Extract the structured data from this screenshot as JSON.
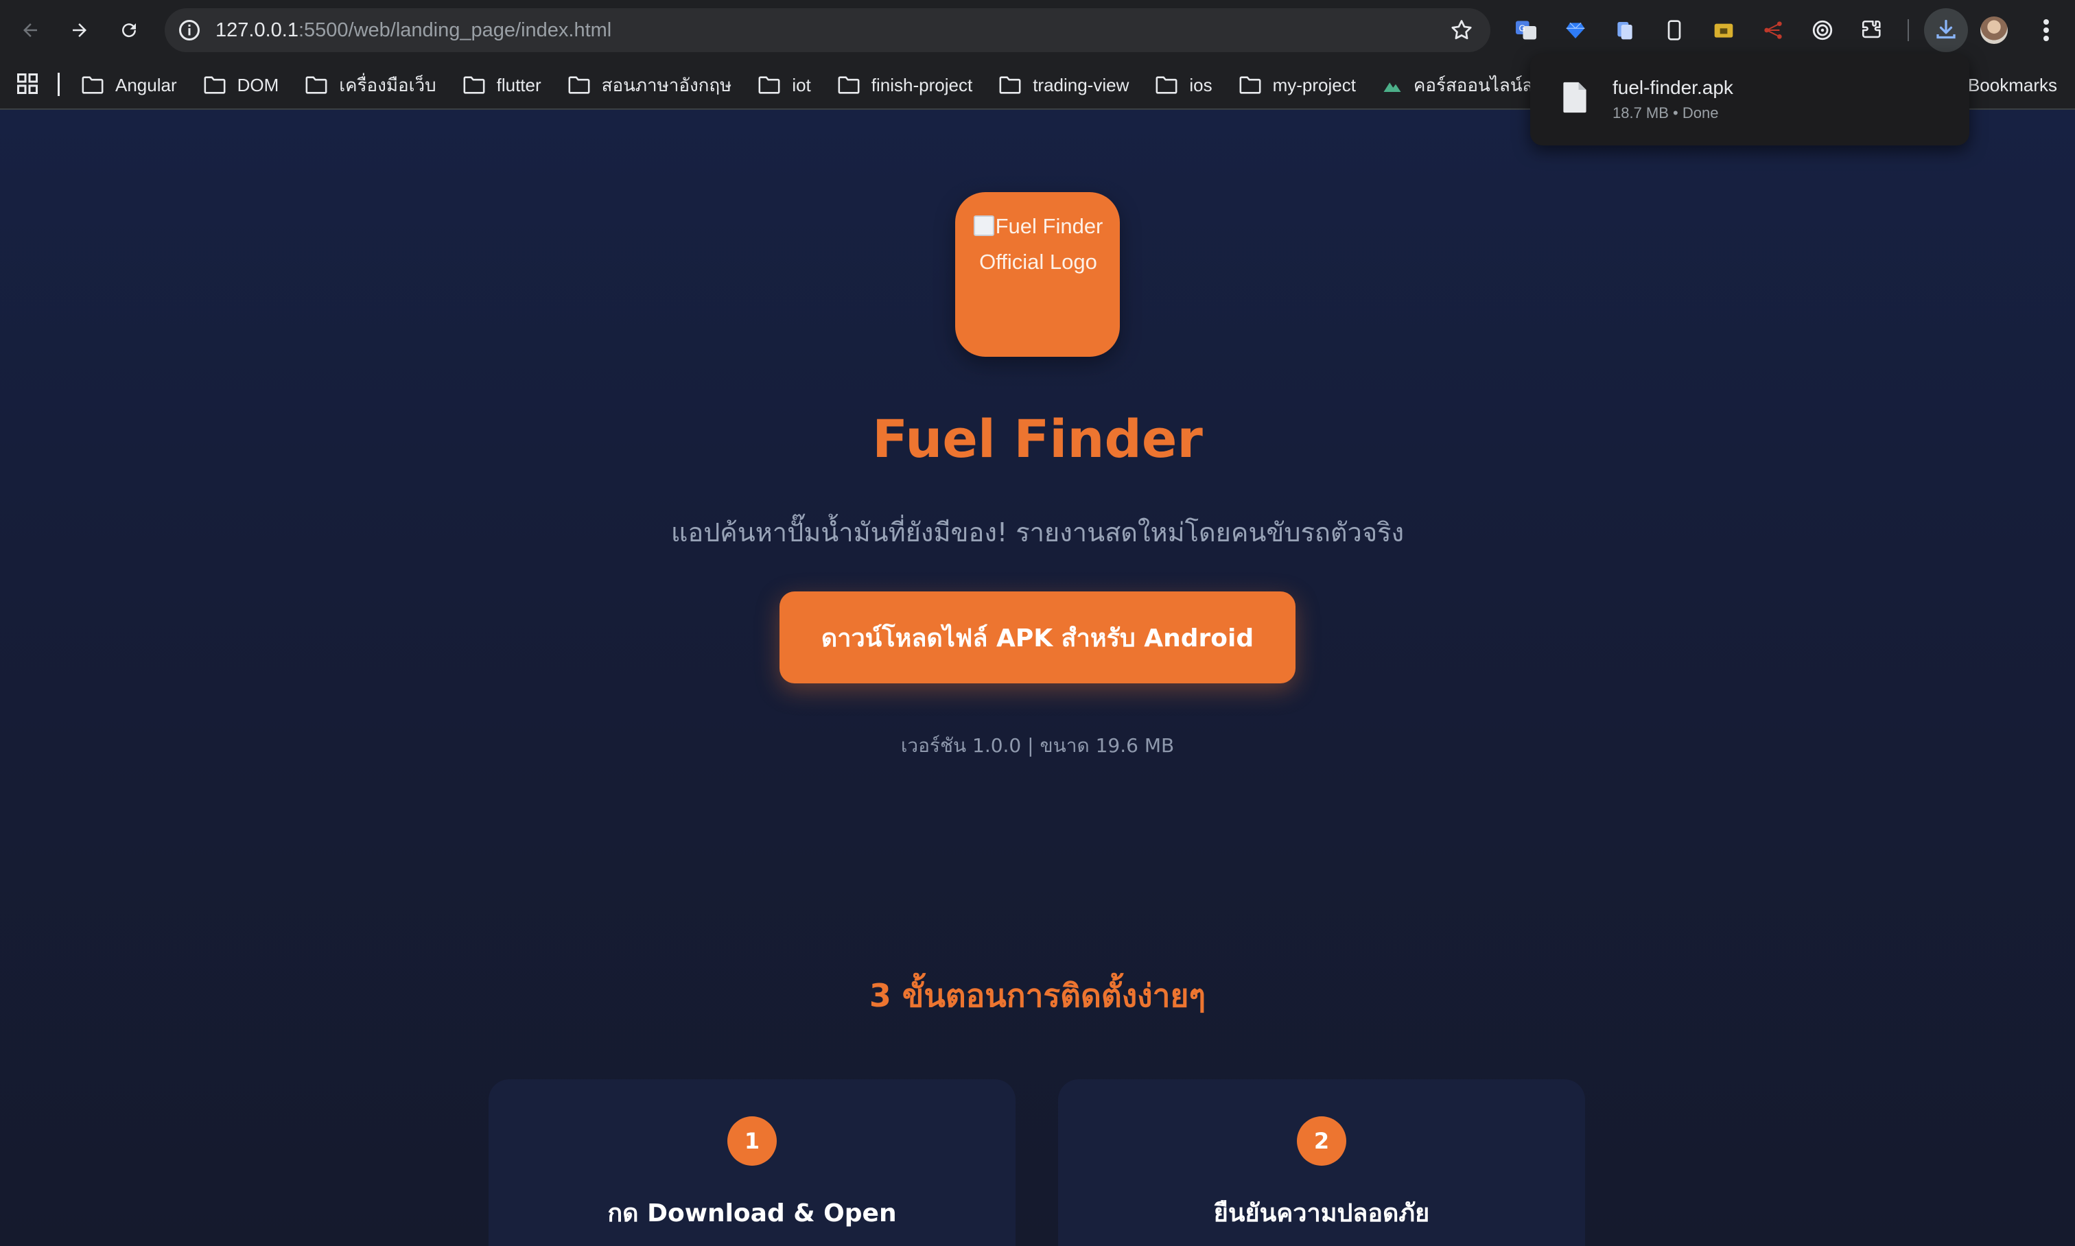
{
  "browser": {
    "url_host": "127.0.0.1",
    "url_path": ":5500/web/landing_page/index.html",
    "bookmarks": [
      {
        "label": "Angular",
        "icon": "folder-icon"
      },
      {
        "label": "DOM",
        "icon": "folder-icon"
      },
      {
        "label": "เครื่องมือเว็บ",
        "icon": "folder-icon"
      },
      {
        "label": "flutter",
        "icon": "folder-icon"
      },
      {
        "label": "สอนภาษาอังกฤษ",
        "icon": "folder-icon"
      },
      {
        "label": "iot",
        "icon": "folder-icon"
      },
      {
        "label": "finish-project",
        "icon": "folder-icon"
      },
      {
        "label": "trading-view",
        "icon": "folder-icon"
      },
      {
        "label": "ios",
        "icon": "folder-icon"
      },
      {
        "label": "my-project",
        "icon": "folder-icon"
      },
      {
        "label": "คอร์สออนไลน์สอนกา...",
        "icon": "site-icon"
      }
    ],
    "all_bookmarks_label": "Bookmarks",
    "download": {
      "filename": "fuel-finder.apk",
      "meta": "18.7 MB • Done"
    }
  },
  "page": {
    "logo_alt": "Fuel Finder Official Logo",
    "title": "Fuel Finder",
    "tagline": "แอปค้นหาปั๊มน้ำมันที่ยังมีของ! รายงานสดใหม่โดยคนขับรถตัวจริง",
    "cta_label": "ดาวน์โหลดไฟล์ APK สำหรับ Android",
    "version_info": "เวอร์ชัน 1.0.0 | ขนาด 19.6 MB",
    "steps_title": "3 ขั้นตอนการติดตั้งง่ายๆ",
    "steps": [
      {
        "number": "1",
        "title": "กด Download & Open"
      },
      {
        "number": "2",
        "title": "ยืนยันความปลอดภัย"
      }
    ]
  },
  "colors": {
    "accent": "#ed7530",
    "page_bg": "#161d38",
    "card_bg": "#18203c",
    "chrome_bg": "#1f2023"
  }
}
